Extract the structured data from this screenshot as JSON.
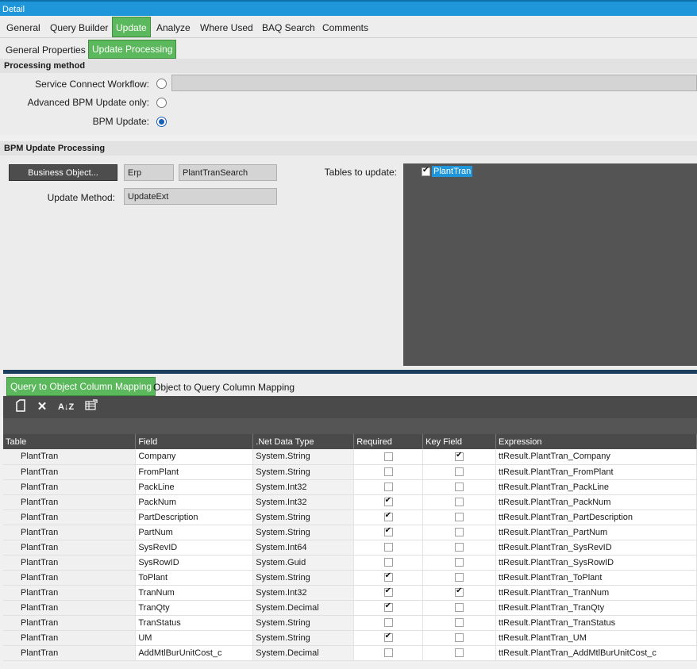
{
  "window": {
    "title": "Detail"
  },
  "main_tabs": [
    "General",
    "Query Builder",
    "Update",
    "Analyze",
    "Where Used",
    "BAQ Search",
    "Comments"
  ],
  "sub_tabs": [
    "General Properties",
    "Update Processing"
  ],
  "processing_method": {
    "title": "Processing method",
    "service_connect_label": "Service Connect Workflow:",
    "advanced_bpm_label": "Advanced BPM Update only:",
    "bpm_update_label": "BPM Update:",
    "selected": "BPM Update"
  },
  "bpm_update": {
    "title": "BPM Update Processing",
    "business_object_button": "Business Object...",
    "bo_system": "Erp",
    "bo_name": "PlantTranSearch",
    "update_method_label": "Update Method:",
    "update_method": "UpdateExt",
    "tables_label": "Tables to update:",
    "tables": [
      {
        "name": "PlantTran",
        "checked": true
      }
    ]
  },
  "mapping_tabs": [
    "Query to Object Column Mapping",
    "Object to Query Column Mapping"
  ],
  "toolbar_icons": [
    "new-icon",
    "delete-icon",
    "sort-icon",
    "grid-settings-icon"
  ],
  "grid": {
    "columns": [
      "Table",
      "Field",
      ".Net Data Type",
      "Required",
      "Key Field",
      "Expression"
    ],
    "rows": [
      {
        "table": "PlantTran",
        "field": "Company",
        "type": "System.String",
        "required": false,
        "key": true,
        "expr": "ttResult.PlantTran_Company"
      },
      {
        "table": "PlantTran",
        "field": "FromPlant",
        "type": "System.String",
        "required": false,
        "key": false,
        "expr": "ttResult.PlantTran_FromPlant"
      },
      {
        "table": "PlantTran",
        "field": "PackLine",
        "type": "System.Int32",
        "required": false,
        "key": false,
        "expr": "ttResult.PlantTran_PackLine"
      },
      {
        "table": "PlantTran",
        "field": "PackNum",
        "type": "System.Int32",
        "required": true,
        "key": false,
        "expr": "ttResult.PlantTran_PackNum"
      },
      {
        "table": "PlantTran",
        "field": "PartDescription",
        "type": "System.String",
        "required": true,
        "key": false,
        "expr": "ttResult.PlantTran_PartDescription"
      },
      {
        "table": "PlantTran",
        "field": "PartNum",
        "type": "System.String",
        "required": true,
        "key": false,
        "expr": "ttResult.PlantTran_PartNum"
      },
      {
        "table": "PlantTran",
        "field": "SysRevID",
        "type": "System.Int64",
        "required": false,
        "key": false,
        "expr": "ttResult.PlantTran_SysRevID"
      },
      {
        "table": "PlantTran",
        "field": "SysRowID",
        "type": "System.Guid",
        "required": false,
        "key": false,
        "expr": "ttResult.PlantTran_SysRowID"
      },
      {
        "table": "PlantTran",
        "field": "ToPlant",
        "type": "System.String",
        "required": true,
        "key": false,
        "expr": "ttResult.PlantTran_ToPlant"
      },
      {
        "table": "PlantTran",
        "field": "TranNum",
        "type": "System.Int32",
        "required": true,
        "key": true,
        "expr": "ttResult.PlantTran_TranNum"
      },
      {
        "table": "PlantTran",
        "field": "TranQty",
        "type": "System.Decimal",
        "required": true,
        "key": false,
        "expr": "ttResult.PlantTran_TranQty"
      },
      {
        "table": "PlantTran",
        "field": "TranStatus",
        "type": "System.String",
        "required": false,
        "key": false,
        "expr": "ttResult.PlantTran_TranStatus"
      },
      {
        "table": "PlantTran",
        "field": "UM",
        "type": "System.String",
        "required": true,
        "key": false,
        "expr": "ttResult.PlantTran_UM"
      },
      {
        "table": "PlantTran",
        "field": "AddMtlBurUnitCost_c",
        "type": "System.Decimal",
        "required": false,
        "key": false,
        "expr": "ttResult.PlantTran_AddMtlBurUnitCost_c"
      }
    ]
  },
  "colors": {
    "accent": "#5cb85c",
    "titlebar": "#1e96d9",
    "dark_panel": "#545454",
    "selection": "#1e96d9"
  }
}
